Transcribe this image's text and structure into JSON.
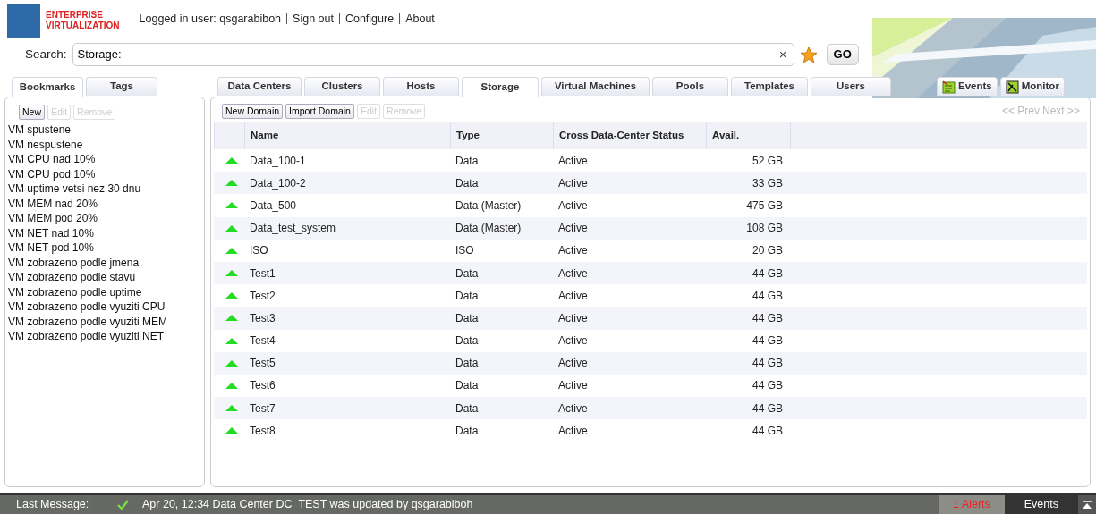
{
  "header": {
    "logo_line1": "ENTERPRISE",
    "logo_line2": "VIRTUALIZATION",
    "user_label": "Logged in user: qsgarabiboh",
    "links": [
      "Sign out",
      "Configure",
      "About"
    ]
  },
  "search": {
    "label": "Search:",
    "value": "Storage:",
    "clear": "×",
    "go": "GO"
  },
  "left_tabs": [
    {
      "label": "Bookmarks",
      "selected": true
    },
    {
      "label": "Tags",
      "selected": false
    }
  ],
  "left_buttons": [
    {
      "label": "New",
      "disabled": false
    },
    {
      "label": "Edit",
      "disabled": true
    },
    {
      "label": "Remove",
      "disabled": true
    }
  ],
  "bookmarks": [
    "VM spustene",
    "VM nespustene",
    "VM CPU nad 10%",
    "VM CPU pod 10%",
    "VM uptime vetsi nez 30 dnu",
    "VM MEM nad 20%",
    "VM MEM pod 20%",
    "VM NET nad 10%",
    "VM NET pod 10%",
    "VM zobrazeno podle jmena",
    "VM zobrazeno podle stavu",
    "VM zobrazeno podle uptime",
    "VM zobrazeno podle vyuziti CPU",
    "VM zobrazeno podle vyuziti MEM",
    "VM zobrazeno podle vyuziti NET"
  ],
  "main_tabs": [
    {
      "label": "Data Centers",
      "selected": false
    },
    {
      "label": "Clusters",
      "selected": false
    },
    {
      "label": "Hosts",
      "selected": false
    },
    {
      "label": "Storage",
      "selected": true
    },
    {
      "label": "Virtual Machines",
      "selected": false
    },
    {
      "label": "Pools",
      "selected": false
    },
    {
      "label": "Templates",
      "selected": false
    },
    {
      "label": "Users",
      "selected": false
    }
  ],
  "side_tabs": [
    {
      "label": "Events",
      "kind": "events"
    },
    {
      "label": "Monitor",
      "kind": "monitor"
    }
  ],
  "toolbar": [
    {
      "label": "New Domain",
      "disabled": false
    },
    {
      "label": "Import Domain",
      "disabled": false
    },
    {
      "label": "Edit",
      "disabled": true
    },
    {
      "label": "Remove",
      "disabled": true
    }
  ],
  "pager": {
    "prev": "<< Prev",
    "next": "Next >>"
  },
  "table": {
    "columns": [
      "Name",
      "Type",
      "Cross Data-Center Status",
      "Avail."
    ],
    "rows": [
      {
        "kind": "up",
        "name": "Data_100-1",
        "type": "Data",
        "cross_status": "Active",
        "avail": "52 GB"
      },
      {
        "kind": "up",
        "name": "Data_100-2",
        "type": "Data",
        "cross_status": "Active",
        "avail": "33 GB"
      },
      {
        "kind": "up",
        "name": "Data_500",
        "type": "Data (Master)",
        "cross_status": "Active",
        "avail": "475 GB"
      },
      {
        "kind": "up",
        "name": "Data_test_system",
        "type": "Data (Master)",
        "cross_status": "Active",
        "avail": "108 GB"
      },
      {
        "kind": "up",
        "name": "ISO",
        "type": "ISO",
        "cross_status": "Active",
        "avail": "20 GB"
      },
      {
        "kind": "up",
        "name": "Test1",
        "type": "Data",
        "cross_status": "Active",
        "avail": "44 GB"
      },
      {
        "kind": "up",
        "name": "Test2",
        "type": "Data",
        "cross_status": "Active",
        "avail": "44 GB"
      },
      {
        "kind": "up",
        "name": "Test3",
        "type": "Data",
        "cross_status": "Active",
        "avail": "44 GB"
      },
      {
        "kind": "up",
        "name": "Test4",
        "type": "Data",
        "cross_status": "Active",
        "avail": "44 GB"
      },
      {
        "kind": "up",
        "name": "Test5",
        "type": "Data",
        "cross_status": "Active",
        "avail": "44 GB"
      },
      {
        "kind": "up",
        "name": "Test6",
        "type": "Data",
        "cross_status": "Active",
        "avail": "44 GB"
      },
      {
        "kind": "up",
        "name": "Test7",
        "type": "Data",
        "cross_status": "Active",
        "avail": "44 GB"
      },
      {
        "kind": "up",
        "name": "Test8",
        "type": "Data",
        "cross_status": "Active",
        "avail": "44 GB"
      }
    ]
  },
  "status_bar": {
    "label": "Last Message:",
    "message": "Apr 20, 12:34 Data Center DC_TEST was updated by qsgarabiboh",
    "alerts": "1 Alerts",
    "events": "Events"
  }
}
